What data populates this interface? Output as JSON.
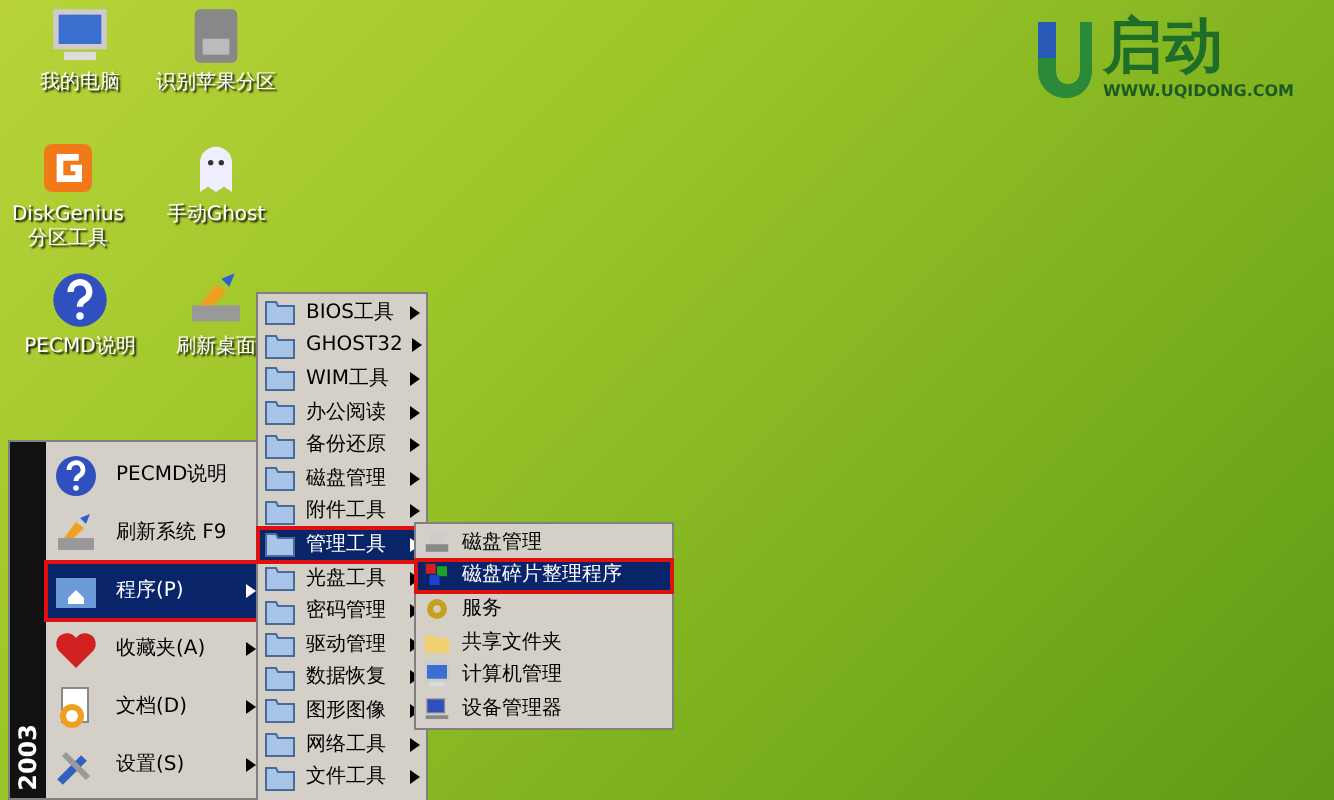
{
  "desktop_icons": [
    {
      "label": "我的电脑",
      "kind": "computer"
    },
    {
      "label": "识别苹果分区",
      "kind": "drive"
    },
    {
      "label": "DiskGenius分区工具",
      "kind": "diskgenius"
    },
    {
      "label": "手动Ghost",
      "kind": "ghost"
    },
    {
      "label": "PECMD说明",
      "kind": "help"
    },
    {
      "label": "刷新桌面",
      "kind": "refresh"
    }
  ],
  "logo": {
    "name": "启动",
    "url": "WWW.UQIDONG.COM"
  },
  "start_menu": {
    "banner": "2003",
    "items": [
      {
        "label": "PECMD说明",
        "kind": "help",
        "submenu": false,
        "selected": false
      },
      {
        "label": "刷新系统 F9",
        "kind": "refresh",
        "submenu": false,
        "selected": false
      },
      {
        "label": "程序(P)",
        "kind": "programs",
        "submenu": true,
        "selected": true
      },
      {
        "label": "收藏夹(A)",
        "kind": "favorites",
        "submenu": true,
        "selected": false
      },
      {
        "label": "文档(D)",
        "kind": "documents",
        "submenu": true,
        "selected": false
      },
      {
        "label": "设置(S)",
        "kind": "settings",
        "submenu": true,
        "selected": false
      }
    ]
  },
  "programs_menu": [
    {
      "label": "BIOS工具",
      "selected": false
    },
    {
      "label": "GHOST32",
      "selected": false
    },
    {
      "label": "WIM工具",
      "selected": false
    },
    {
      "label": "办公阅读",
      "selected": false
    },
    {
      "label": "备份还原",
      "selected": false
    },
    {
      "label": "磁盘管理",
      "selected": false
    },
    {
      "label": "附件工具",
      "selected": false
    },
    {
      "label": "管理工具",
      "selected": true
    },
    {
      "label": "光盘工具",
      "selected": false
    },
    {
      "label": "密码管理",
      "selected": false
    },
    {
      "label": "驱动管理",
      "selected": false
    },
    {
      "label": "数据恢复",
      "selected": false
    },
    {
      "label": "图形图像",
      "selected": false
    },
    {
      "label": "网络工具",
      "selected": false
    },
    {
      "label": "文件工具",
      "selected": false
    }
  ],
  "admin_menu": [
    {
      "label": "磁盘管理",
      "kind": "disk",
      "selected": false
    },
    {
      "label": "磁盘碎片整理程序",
      "kind": "defrag",
      "selected": true
    },
    {
      "label": "服务",
      "kind": "gear",
      "selected": false
    },
    {
      "label": "共享文件夹",
      "kind": "folder",
      "selected": false
    },
    {
      "label": "计算机管理",
      "kind": "computer",
      "selected": false
    },
    {
      "label": "设备管理器",
      "kind": "device",
      "selected": false
    }
  ]
}
